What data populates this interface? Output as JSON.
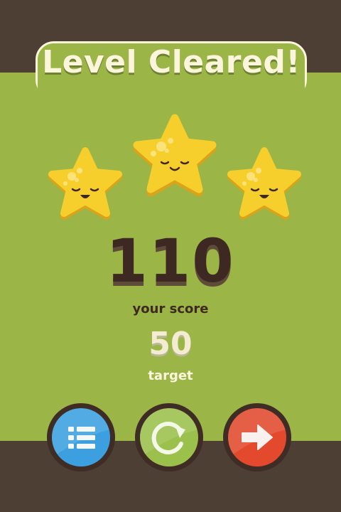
{
  "title": "Level Cleared!",
  "stars": {
    "earned": 3,
    "total": 3,
    "fill_color": "#f7cf2c"
  },
  "score": {
    "value": "110",
    "label": "your score"
  },
  "target": {
    "value": "50",
    "label": "target"
  },
  "buttons": {
    "menu": {
      "icon": "list-icon",
      "color": "#3ca0e0"
    },
    "replay": {
      "icon": "replay-icon",
      "color": "#9bc14c"
    },
    "next": {
      "icon": "arrow-right-icon",
      "color": "#e2492d"
    }
  },
  "colors": {
    "background": "#4e3f35",
    "panel": "#9bb546",
    "title_text": "#fbf5dc",
    "score_text": "#3e2922"
  }
}
